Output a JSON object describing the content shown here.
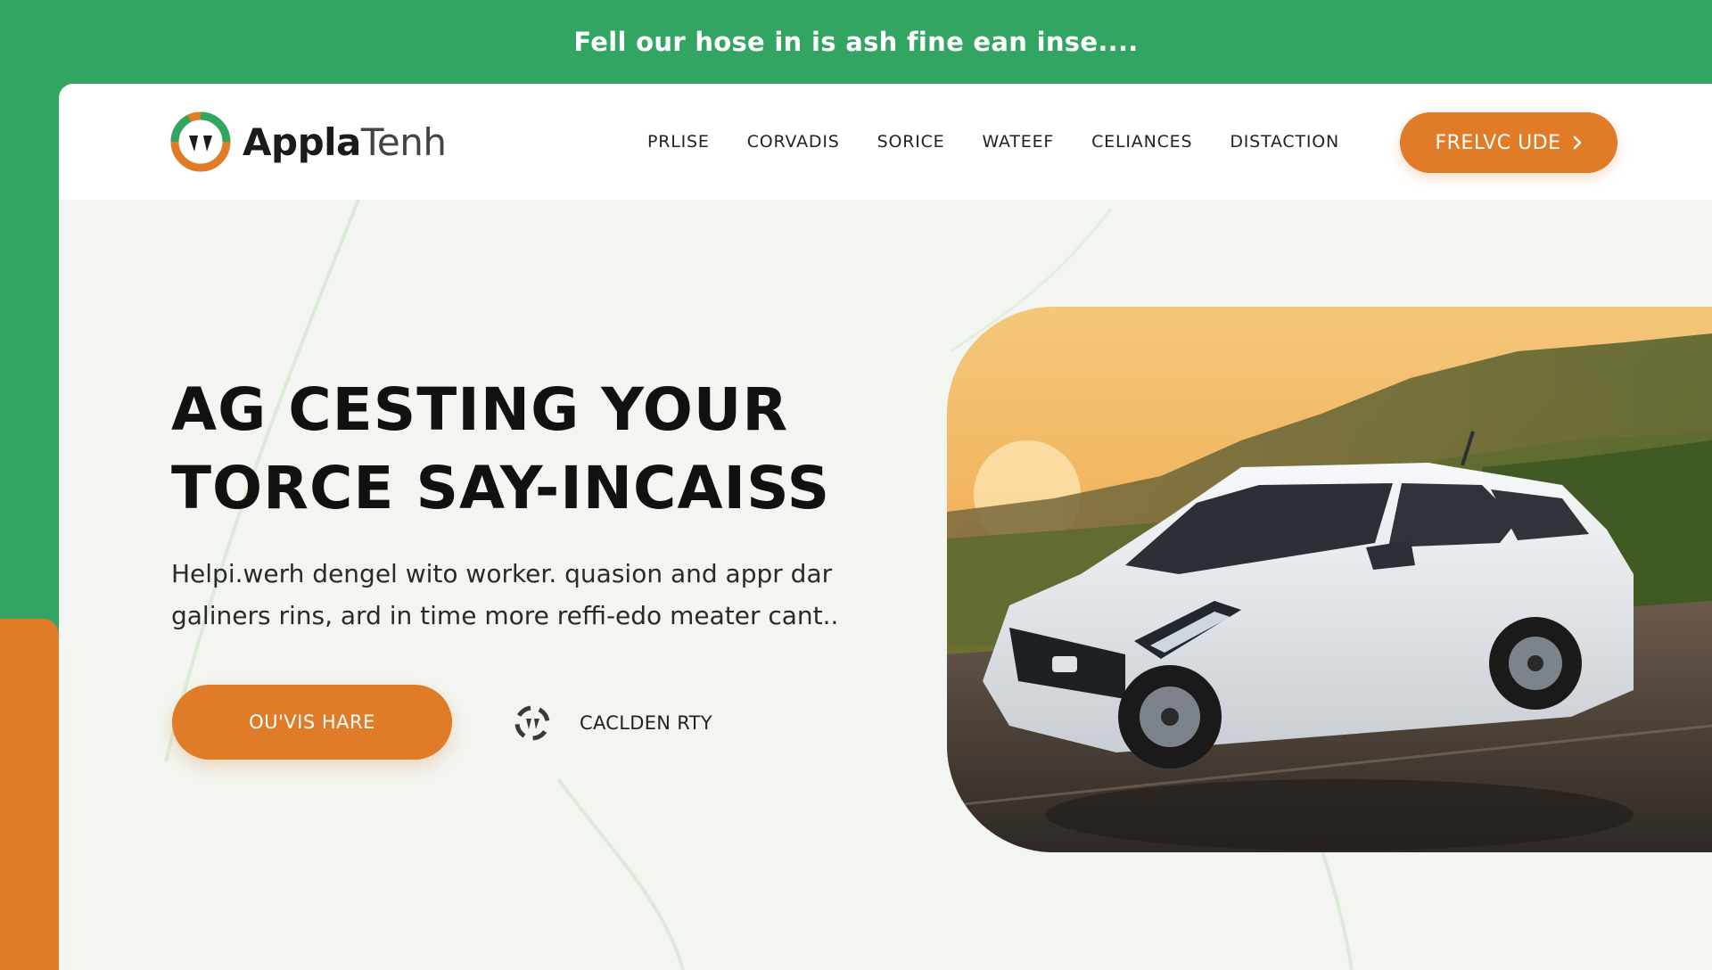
{
  "announcement": {
    "text": "Fell our hose in is ash fine ean inse...."
  },
  "brand": {
    "name_bold": "Appla",
    "name_light": "Tenh",
    "colors": {
      "green": "#33a562",
      "orange": "#e07b27"
    }
  },
  "nav": {
    "items": [
      {
        "label": "PRLISE"
      },
      {
        "label": "CORVADIS"
      },
      {
        "label": "SORICE"
      },
      {
        "label": "WATEEF"
      },
      {
        "label": "CELIANCES"
      },
      {
        "label": "DISTACTION"
      }
    ],
    "cta_label": "FRELVC UDE",
    "cta_icon": "chevron-right-icon"
  },
  "hero": {
    "title_line1": "AG CESTING YOUR",
    "title_line2": "TORCE SAY-INCAISS",
    "description_line1": "Helpi.werh dengel wito worker. quasion and appr dar",
    "description_line2": "galiners rins, ard in time more reffi-edo meater cant..",
    "primary_button": "OU'VIS HARE",
    "secondary_link": "CACLDEN RTY",
    "secondary_icon": "refresh-cycle-icon",
    "image": "white compact SUV driving on a road at sunset with hills"
  }
}
